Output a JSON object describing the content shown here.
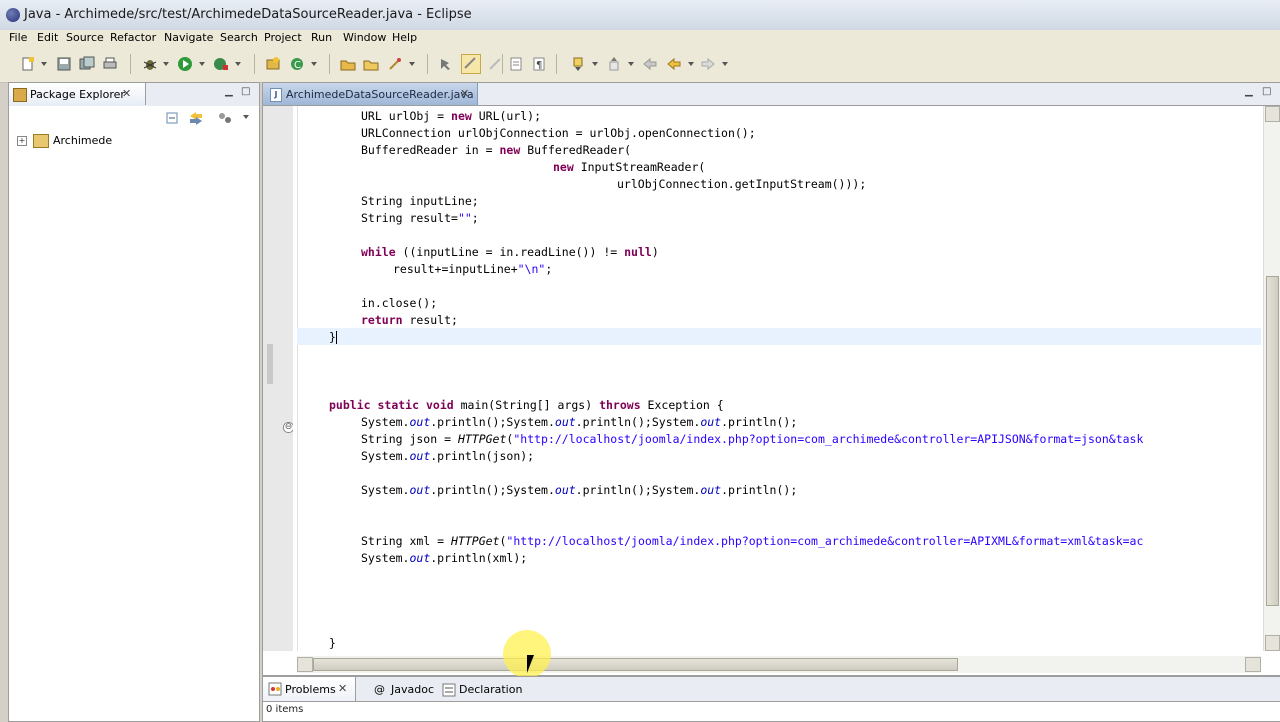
{
  "window": {
    "title": "Java - Archimede/src/test/ArchimedeDataSourceReader.java - Eclipse"
  },
  "menu": [
    "File",
    "Edit",
    "Source",
    "Refactor",
    "Navigate",
    "Search",
    "Project",
    "Run",
    "Window",
    "Help"
  ],
  "package_explorer": {
    "tab_label": "Package Explorer",
    "tree": [
      {
        "label": "Archimede",
        "expander": "+"
      }
    ]
  },
  "editor": {
    "tab_label": "ArchimedeDataSourceReader.java",
    "lines": {
      "l1a": "URL urlObj = ",
      "l1b": "new",
      "l1c": " URL(url);",
      "l2": "URLConnection urlObjConnection = urlObj.openConnection();",
      "l3a": "BufferedReader in = ",
      "l3b": "new",
      "l3c": " BufferedReader(",
      "l4a": "new",
      "l4b": " InputStreamReader(",
      "l5": "urlObjConnection.getInputStream()));",
      "l6": "String inputLine;",
      "l7a": "String result=",
      "l7b": "\"\"",
      "l7c": ";",
      "l8a": "while",
      "l8b": " ((inputLine = in.readLine()) != ",
      "l8c": "null",
      "l8d": ")",
      "l9a": "result+=inputLine+",
      "l9b": "\"\\n\"",
      "l9c": ";",
      "l10": "in.close();",
      "l11a": "return",
      "l11b": " result;",
      "l12": "}",
      "m1a": "public",
      "m1b": "static",
      "m1c": "void",
      "m1d": " main(String[] args) ",
      "m1e": "throws",
      "m1f": " Exception {",
      "sys": "System.",
      "out": "out",
      "println": ".println();",
      "m3a": "String json = ",
      "m3b": "HTTPGet",
      "m3c": "(",
      "m3d": "\"http://localhost/joomla/index.php?option=com_archimede&controller=APIJSON&format=json&task",
      "m4c": ".println(json);",
      "m6a": "String xml = ",
      "m6d": "\"http://localhost/joomla/index.php?option=com_archimede&controller=APIXML&format=xml&task=ac",
      "m7c": ".println(xml);",
      "close": "}",
      "fold": "⊖"
    }
  },
  "bottom_panel": {
    "tabs": [
      {
        "label": "Problems",
        "active": true
      },
      {
        "label": "Javadoc",
        "active": false
      },
      {
        "label": "Declaration",
        "active": false
      }
    ],
    "status": "0 items"
  }
}
